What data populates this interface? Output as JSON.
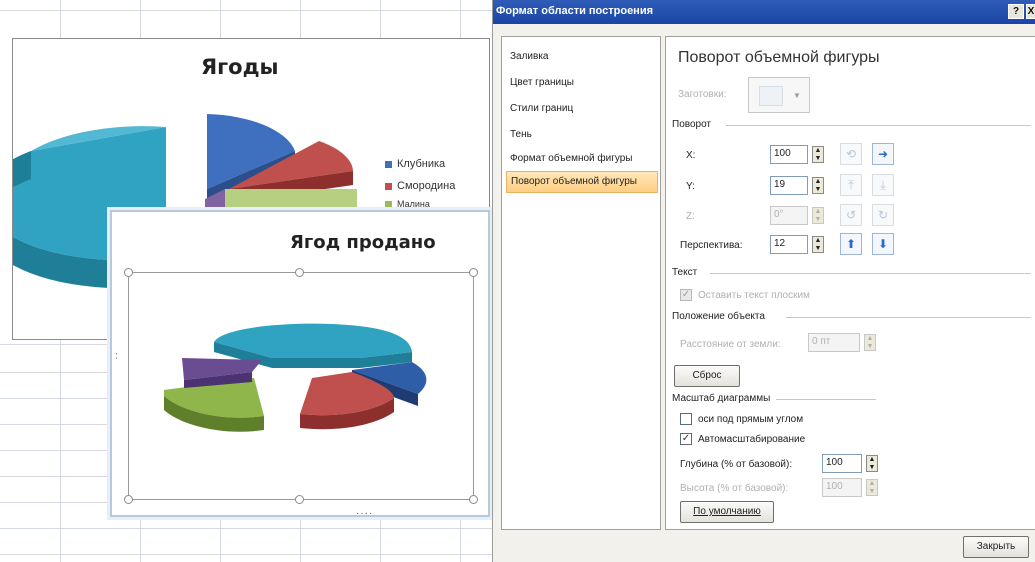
{
  "sheet": {
    "chart1": {
      "title": "Ягоды",
      "legend": [
        {
          "label": "Клубника",
          "color": "#3f6fbf"
        },
        {
          "label": "Смородина",
          "color": "#c0504d"
        },
        {
          "label": "Малина",
          "color": "#9bbb59"
        }
      ]
    },
    "chart2": {
      "title": "Ягод продано"
    }
  },
  "dialog": {
    "title": "Формат области построения",
    "help_btn": "?",
    "close_btn": "X",
    "nav": [
      {
        "label": "Заливка",
        "selected": false
      },
      {
        "label": "Цвет границы",
        "selected": false
      },
      {
        "label": "Стили границ",
        "selected": false
      },
      {
        "label": "Тень",
        "selected": false
      },
      {
        "label": "Формат объемной фигуры",
        "selected": false
      },
      {
        "label": "Поворот объемной фигуры",
        "selected": true
      }
    ],
    "content": {
      "heading": "Поворот объемной фигуры",
      "presets_label": "Заготовки:",
      "rotation_group": "Поворот",
      "x_label": "X:",
      "x_value": "100",
      "y_label": "Y:",
      "y_value": "19",
      "z_label": "Z:",
      "z_value": "0°",
      "perspective_label": "Перспектива:",
      "perspective_value": "12",
      "text_group": "Текст",
      "keep_text_flat": "Оставить текст плоским",
      "object_position_group": "Положение объекта",
      "distance_from_ground": "Расстояние от земли:",
      "distance_value": "0 пт",
      "reset_btn": "Сброс",
      "chart_scale_group": "Масштаб диаграммы",
      "right_angle_axes": "оси под прямым углом",
      "right_angle_axes_checked": false,
      "autoscale": "Автомасштабирование",
      "autoscale_checked": true,
      "depth_label": "Глубина (% от базовой):",
      "depth_value": "100",
      "height_label": "Высота (% от базовой):",
      "height_value": "100",
      "default_btn": "По умолчанию"
    },
    "close_button": "Закрыть"
  }
}
